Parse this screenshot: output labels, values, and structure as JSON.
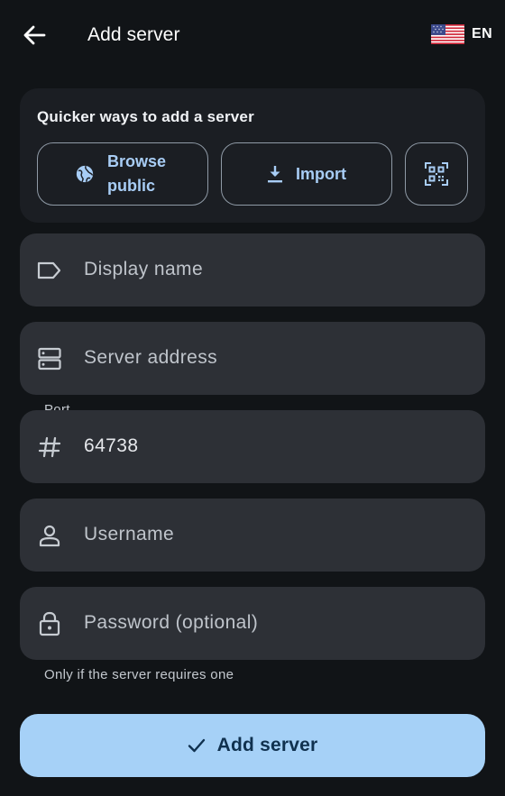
{
  "header": {
    "title": "Add server",
    "language_code": "EN",
    "back_icon": "arrow-left-icon",
    "flag_icon": "us-flag-icon"
  },
  "quick_add": {
    "title": "Quicker ways to add a server",
    "browse_label": "Browse public",
    "browse_icon": "globe-icon",
    "import_label": "Import",
    "import_icon": "download-icon",
    "qr_icon": "qr-scan-icon"
  },
  "form": {
    "display_name": {
      "placeholder": "Display name",
      "icon": "label-tag-icon"
    },
    "server_address": {
      "placeholder": "Server address",
      "icon": "server-icon"
    },
    "port": {
      "label": "Port",
      "value": "64738",
      "icon": "hash-icon"
    },
    "username": {
      "placeholder": "Username",
      "icon": "person-icon"
    },
    "password": {
      "placeholder": "Password (optional)",
      "icon": "lock-icon",
      "hint": "Only if the server requires one"
    }
  },
  "submit": {
    "label": "Add server",
    "icon": "check-icon"
  },
  "colors": {
    "background": "#111417",
    "card": "#1b1e23",
    "field": "#2d3036",
    "accent": "#a8cdf5",
    "primary_button": "#a6d1f7",
    "primary_button_text": "#10314f"
  }
}
